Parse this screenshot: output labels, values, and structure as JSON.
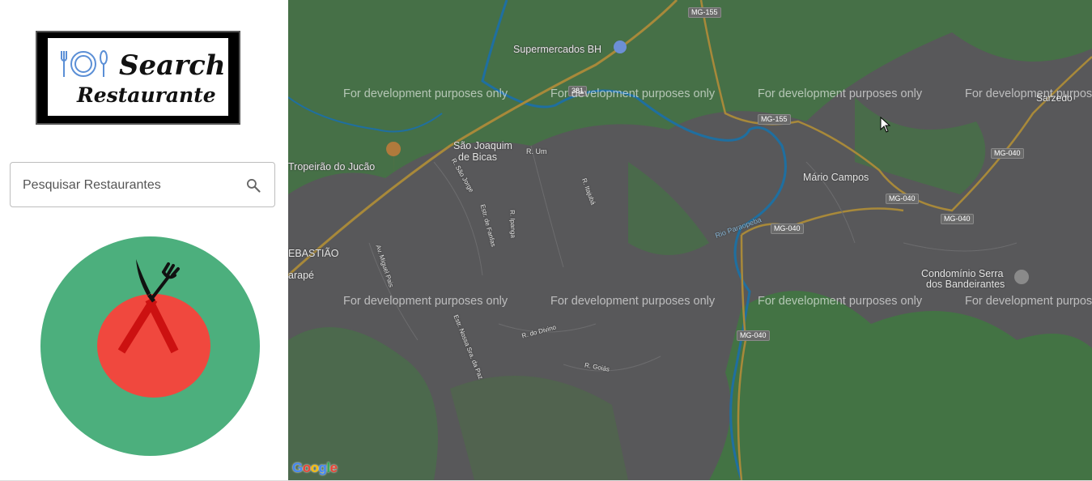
{
  "logo": {
    "line1": "Search",
    "line2": "Restaurante",
    "icon": "cutlery-plate-icon"
  },
  "search": {
    "placeholder": "Pesquisar Restaurantes",
    "value": "",
    "icon": "search-icon"
  },
  "badge": {
    "icon": "fork-knife-tomato-icon",
    "colors": {
      "circle": "#4caf7d",
      "tomato": "#f0483e",
      "strap": "#cc1111"
    }
  },
  "map": {
    "watermark": "For development purposes only",
    "places": [
      "Supermercados BH",
      "São Joaquim",
      "de Bicas",
      "Tropeirão do Jucão",
      "Mário Campos",
      "Condomínio Serra",
      "dos Bandeirantes",
      "EBASTIÃO",
      "arapé",
      "Sarzedo"
    ],
    "streets": [
      "R. Um",
      "R. São Jorge",
      "Estr. de Fanfas",
      "R. Itajubá",
      "R. Ipanga",
      "Av. Miguel Pais",
      "Estr. Nossa Sra. da Paz",
      "R. do Divino",
      "R. Goiás",
      "Rio Paraopeba"
    ],
    "shields": [
      "MG-155",
      "381",
      "MG-155",
      "MG-040",
      "MG-040",
      "MG-040",
      "MG-040",
      "MG-040"
    ],
    "attribution": "Google",
    "colors": {
      "base": "#575759",
      "park": "#3f7a3f",
      "river": "#1f6fa0",
      "highway": "#a8893a"
    }
  }
}
